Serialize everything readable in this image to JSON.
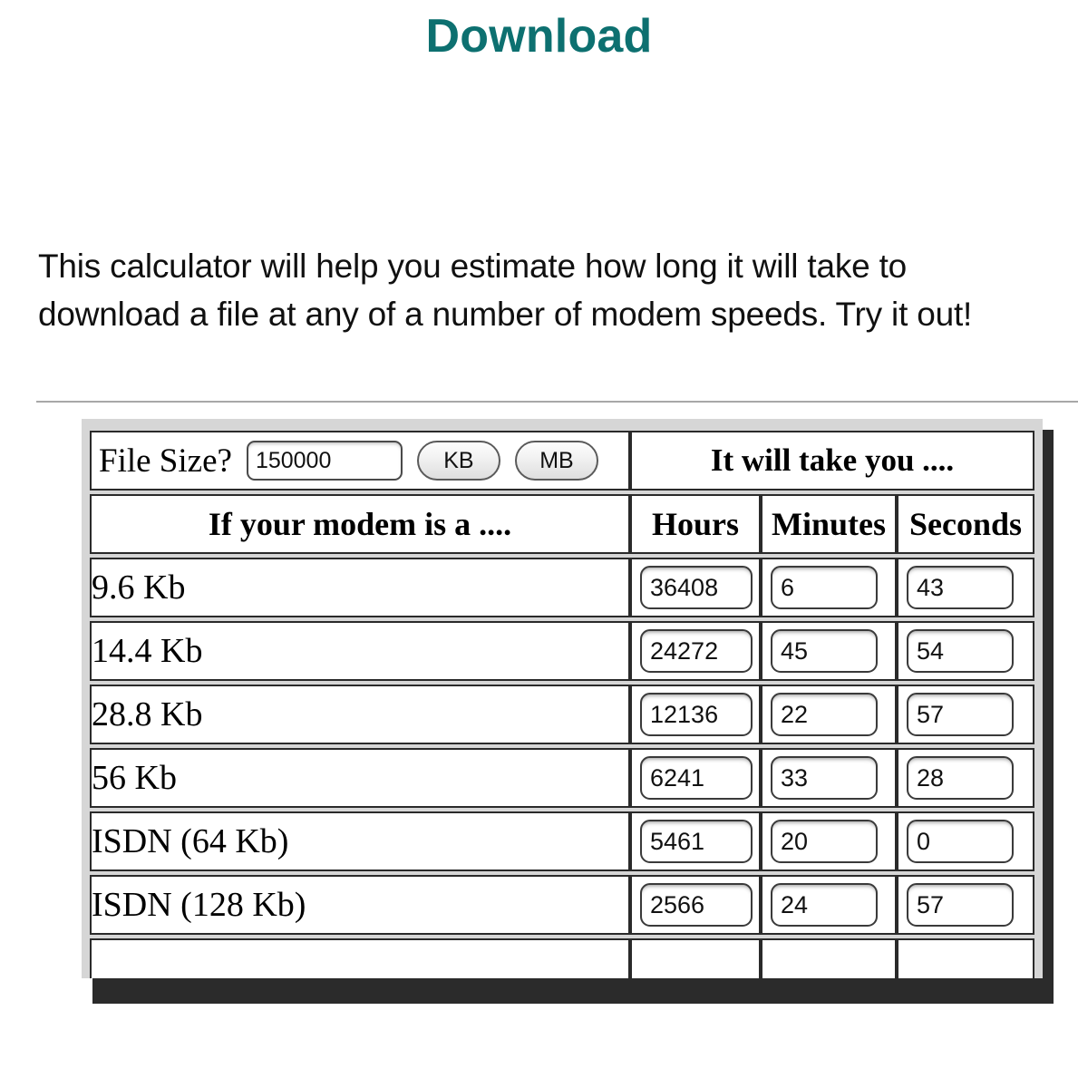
{
  "page": {
    "title": "Download",
    "title_color": "#0d7070",
    "intro": "This calculator will help you estimate how long it will take to download a file at any of a number of modem speeds. Try it out!"
  },
  "calculator": {
    "filesize_label": "File Size?",
    "filesize_value": "150000",
    "filesize_placeholder": "",
    "unit_kb_label": "KB",
    "unit_mb_label": "MB",
    "result_heading": "It will take you ....",
    "modem_heading": "If your modem is a ....",
    "columns": [
      "Hours",
      "Minutes",
      "Seconds"
    ],
    "rows": [
      {
        "modem": "9.6 Kb",
        "hours": "36408",
        "minutes": "6",
        "seconds": "43"
      },
      {
        "modem": "14.4 Kb",
        "hours": "24272",
        "minutes": "45",
        "seconds": "54"
      },
      {
        "modem": "28.8 Kb",
        "hours": "12136",
        "minutes": "22",
        "seconds": "57"
      },
      {
        "modem": "56 Kb",
        "hours": "6241",
        "minutes": "33",
        "seconds": "28"
      },
      {
        "modem": "ISDN (64 Kb)",
        "hours": "5461",
        "minutes": "20",
        "seconds": "0"
      },
      {
        "modem": "ISDN (128 Kb)",
        "hours": "2566",
        "minutes": "24",
        "seconds": "57"
      }
    ]
  }
}
